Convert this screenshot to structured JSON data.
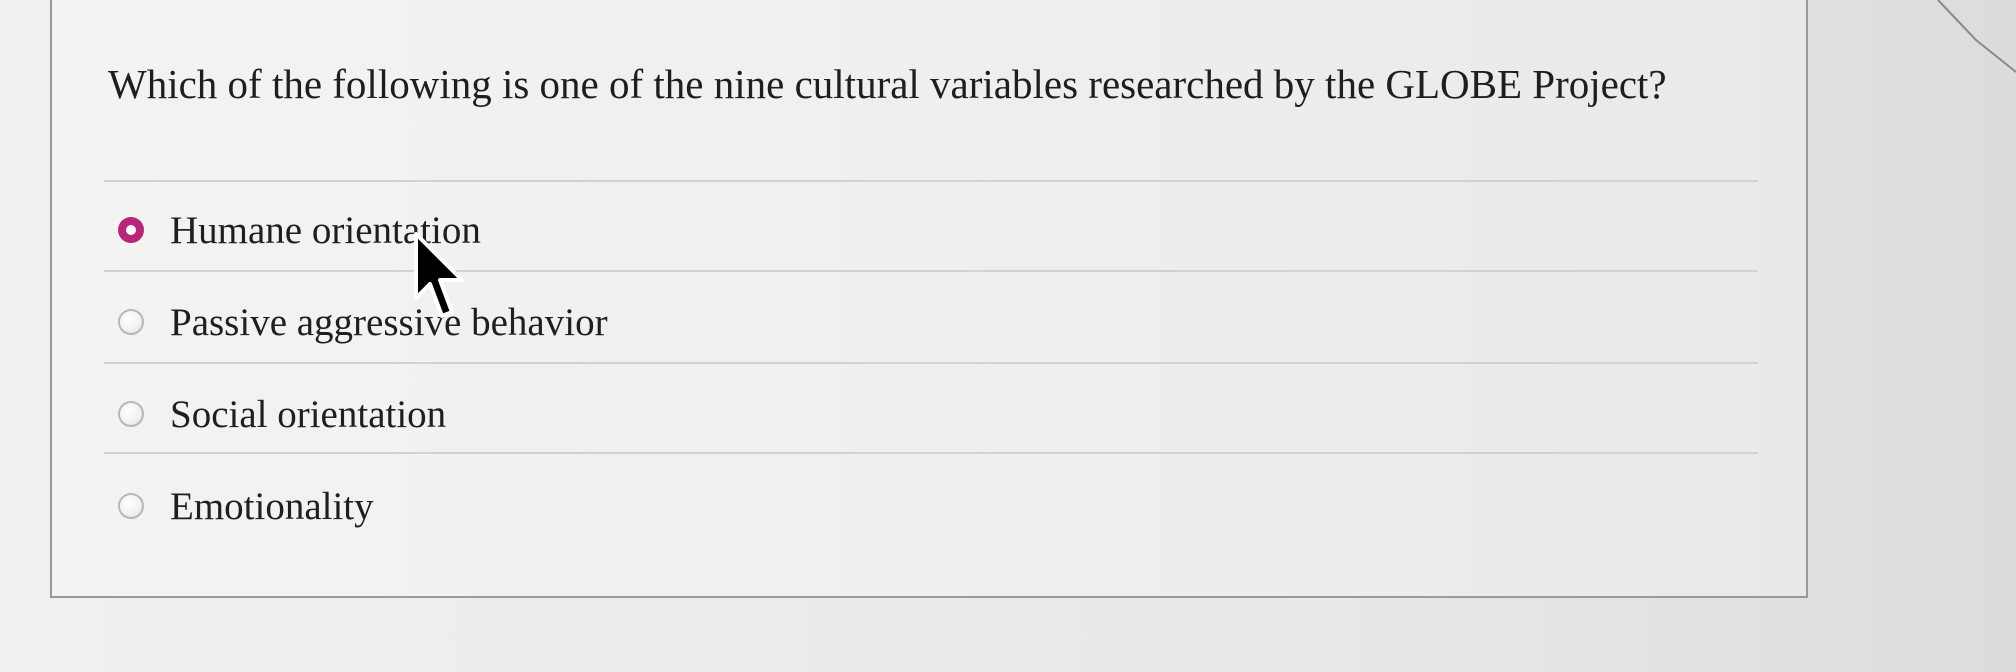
{
  "question": {
    "text": "Which of the following is one of the nine cultural variables researched by the GLOBE Project?"
  },
  "options": [
    {
      "label": "Humane orientation",
      "selected": true
    },
    {
      "label": "Passive aggressive behavior",
      "selected": false
    },
    {
      "label": "Social orientation",
      "selected": false
    },
    {
      "label": "Emotionality",
      "selected": false
    }
  ],
  "colors": {
    "selected_radio": "#b8257a",
    "text": "#1e1e1e",
    "border": "#9a9a9a"
  },
  "icons": {
    "pointer": "mouse-pointer-icon"
  }
}
